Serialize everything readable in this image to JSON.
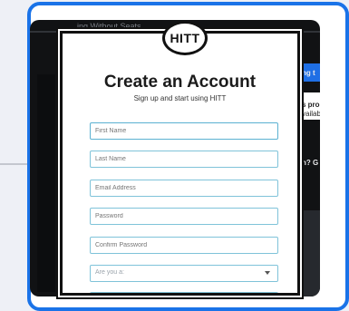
{
  "background": {
    "topbar_text": "ing Without Seats",
    "side_texts": [
      "ng t",
      "s pro",
      "vailab",
      "n? G"
    ]
  },
  "modal": {
    "logo_text": "HITT",
    "title": "Create an Account",
    "subtitle": "Sign up and start using HITT",
    "fields": {
      "first_name": "First Name",
      "last_name": "Last Name",
      "email": "Email Address",
      "password": "Password",
      "confirm_password": "Confirm Password",
      "role": "Are you a:"
    }
  },
  "colors": {
    "frame_border": "#1a73e8",
    "field_border": "#7fc3d9",
    "accent_strip": "#1f6fe5"
  }
}
